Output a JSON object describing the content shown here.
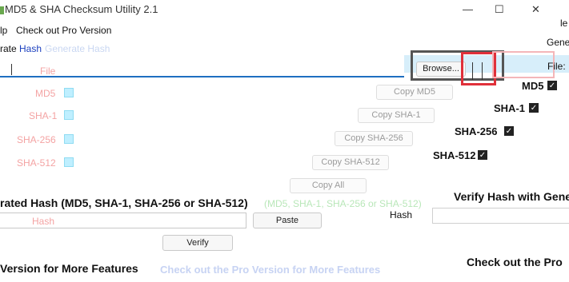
{
  "window": {
    "title": "MD5 & SHA Checksum Utility 2.1",
    "controls": {
      "minimize": "—",
      "maximize": "☐",
      "close": "✕"
    }
  },
  "menu": {
    "left_fragment": "lp",
    "pro_link": "Check out Pro Version"
  },
  "tabs": {
    "left_fragment": "rate",
    "active": "Hash",
    "ghost": "Generate Hash",
    "right_fragment": "Gene"
  },
  "generate": {
    "file_label": "File",
    "file_label_right": "File:",
    "browse_button": "Browse...",
    "file_value": "",
    "rows": [
      {
        "label": "MD5",
        "copy": "Copy MD5"
      },
      {
        "label": "SHA-1",
        "copy": "Copy SHA-1"
      },
      {
        "label": "SHA-256",
        "copy": "Copy SHA-256"
      },
      {
        "label": "SHA-512",
        "copy": "Copy SHA-512"
      }
    ],
    "copy_all": "Copy All",
    "right_labels": [
      "MD5",
      "SHA-1",
      "SHA-256",
      "SHA-512"
    ]
  },
  "verify": {
    "header": "rated Hash (MD5, SHA-1, SHA-256 or SHA-512)",
    "header_ghost": "(MD5, SHA-1, SHA-256 or SHA-512)",
    "hash_label_pink": "Hash",
    "hash_label": "Hash",
    "paste_button": "Paste",
    "verify_button": "Verify",
    "right_header": "Verify Hash with Gene",
    "hash_value": ""
  },
  "footer": {
    "left": "Version for More Features",
    "middle": "Check out the Pro Version for More Features",
    "right": "Check out the Pro"
  },
  "colors": {
    "accent_red": "#e0303a",
    "highlight_blue": "#d7eefa",
    "link_blue": "#2f66d0",
    "line_blue": "#1e6fc1"
  }
}
